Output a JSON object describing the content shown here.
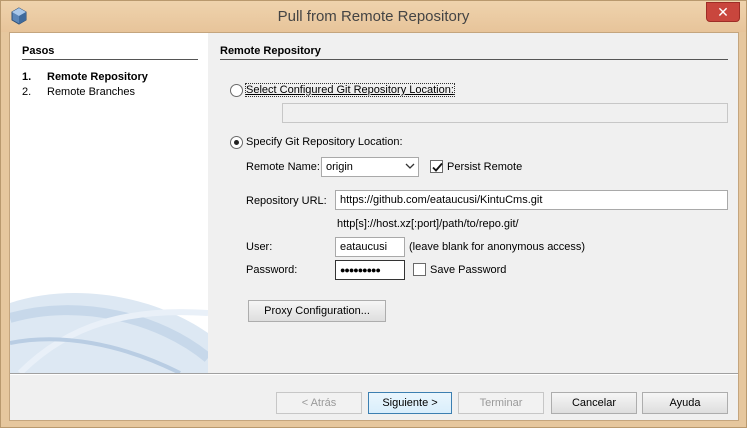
{
  "window": {
    "title": "Pull from Remote Repository",
    "close_glyph": "✕"
  },
  "sidebar": {
    "title": "Pasos",
    "steps": [
      {
        "num": "1.",
        "label": "Remote Repository",
        "active": true
      },
      {
        "num": "2.",
        "label": "Remote Branches",
        "active": false
      }
    ]
  },
  "main": {
    "section_title": "Remote Repository",
    "option_configured": {
      "label": "Select Configured Git Repository Location:",
      "checked": false,
      "value": ""
    },
    "option_specify": {
      "label": "Specify Git Repository Location:",
      "checked": true
    },
    "remote_name": {
      "label": "Remote Name:",
      "value": "origin"
    },
    "persist_remote": {
      "label": "Persist Remote",
      "checked": true
    },
    "repository_url": {
      "label": "Repository URL:",
      "value": "https://github.com/eataucusi/KintuCms.git",
      "hint": "http[s]://host.xz[:port]/path/to/repo.git/"
    },
    "user": {
      "label": "User:",
      "value": "eataucusi",
      "hint": "(leave blank for anonymous access)"
    },
    "password": {
      "label": "Password:",
      "value": "●●●●●●●●●"
    },
    "save_password": {
      "label": "Save Password",
      "checked": false
    },
    "proxy_button": "Proxy Configuration..."
  },
  "footer": {
    "back": "< Atrás",
    "next": "Siguiente >",
    "finish": "Terminar",
    "cancel": "Cancelar",
    "help": "Ayuda"
  },
  "colors": {
    "title_bar": "#e7c49a",
    "close_button": "#c9463d",
    "default_button_border": "#3c7fb1"
  },
  "icons": {
    "app": "cube-icon",
    "close": "close-icon",
    "dropdown": "chevron-down-icon",
    "check": "checkmark-icon"
  }
}
